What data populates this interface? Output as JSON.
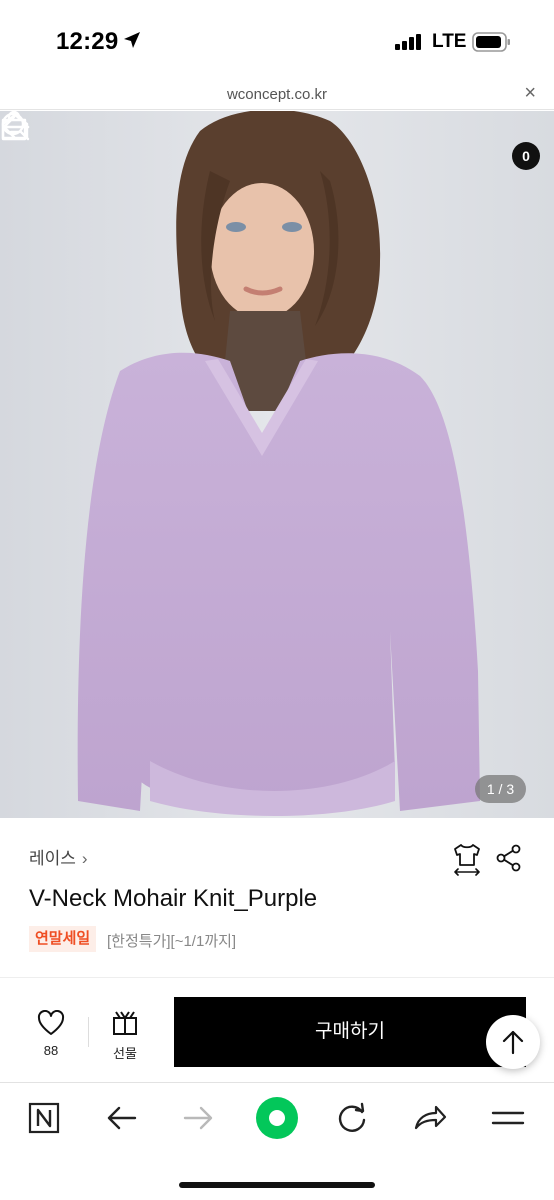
{
  "status_bar": {
    "time": "12:29",
    "network": "LTE",
    "icons": [
      "location-arrow-icon",
      "signal-bars-icon",
      "battery-icon"
    ]
  },
  "url_bar": {
    "url": "wconcept.co.kr",
    "close_icon": "×"
  },
  "hero": {
    "image_counter": "1 / 3",
    "cart_count": "0",
    "icons": [
      "back-arrow-icon",
      "home-icon",
      "search-icon",
      "shopping-bag-icon"
    ]
  },
  "product": {
    "brand": "레이스",
    "brand_chevron": "›",
    "name": "V-Neck Mohair Knit_Purple",
    "sale_badge": "연말세일",
    "sale_note": "[한정특가][~1/1까지]",
    "colors": {
      "sale": "#ef4e23",
      "sale_bg": "#fdeee8"
    }
  },
  "purchase_bar": {
    "like_count": "88",
    "gift_label": "선물",
    "buy_label": "구매하기"
  },
  "toolbar": {
    "icons": [
      "naver-n-icon",
      "back-icon",
      "forward-icon",
      "green-dot-icon",
      "reload-icon",
      "share-icon",
      "menu-icon"
    ],
    "accent": "#03c75a"
  }
}
